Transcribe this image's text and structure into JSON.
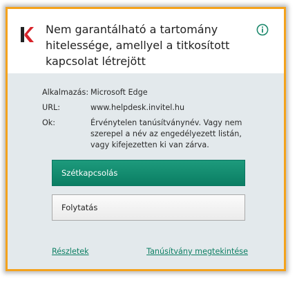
{
  "dialog": {
    "title": "Nem garantálható a tartomány hitelessége, amellyel a titkosított kapcsolat létrejött",
    "accent_color": "#f4a21c",
    "brand_color": "#0b7e63"
  },
  "details": {
    "app_label": "Alkalmazás:",
    "app_value": "Microsoft Edge",
    "url_label": "URL:",
    "url_value": "www.helpdesk.invitel.hu",
    "reason_label": "Ok:",
    "reason_value": "Érvénytelen tanúsítványnév. Vagy nem szerepel a név az engedélyezett listán, vagy kifejezetten ki van zárva."
  },
  "buttons": {
    "disconnect_label": "Szétkapcsolás",
    "continue_label": "Folytatás"
  },
  "links": {
    "details_label": "Részletek",
    "view_certificate_label": "Tanúsítvány megtekintése"
  },
  "icons": {
    "logo": "kaspersky-k-icon",
    "info": "info-circle-icon"
  }
}
